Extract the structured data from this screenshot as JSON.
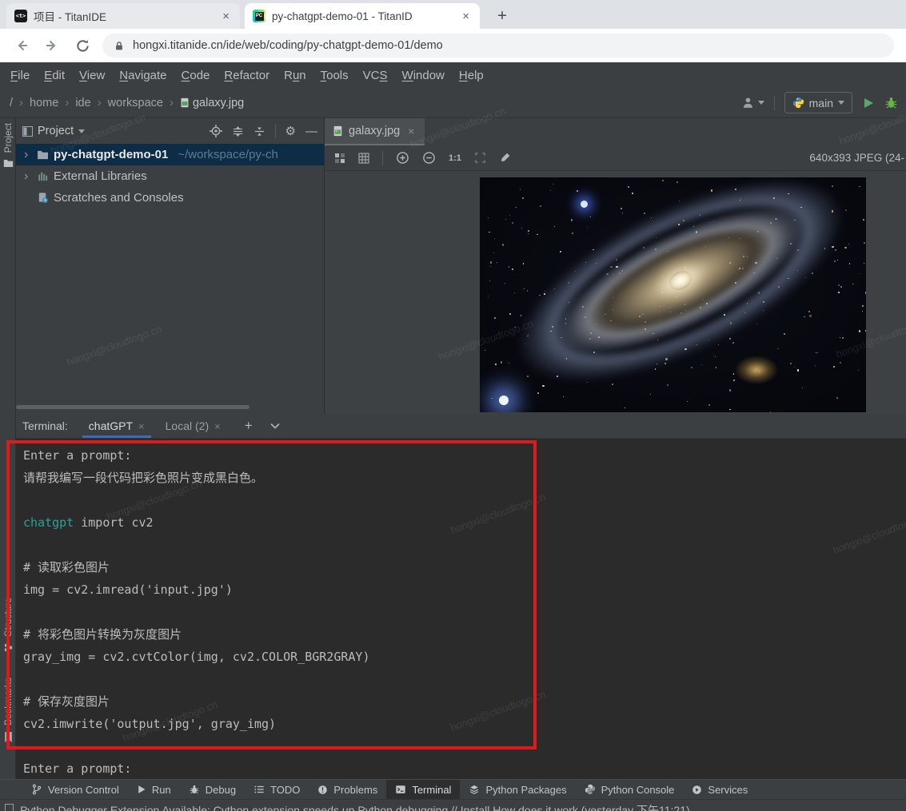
{
  "colors": {
    "accent_teal": "#2aa198",
    "red_box": "#e01a1a",
    "tree_selection": "#0d2c45",
    "terminal_tab_underline": "#3a6db3",
    "run_green": "#59a869",
    "bug_green": "#62b543"
  },
  "browser": {
    "tabs": [
      {
        "title": "项目 - TitanIDE",
        "favicon": "titanide-logo",
        "favicon_glyph": "<t>"
      },
      {
        "title": "py-chatgpt-demo-01 - TitanID",
        "favicon": "pycharm-logo",
        "favicon_glyph": "PC"
      }
    ],
    "new_tab_label": "+",
    "url": "hongxi.titanide.cn/ide/web/coding/py-chatgpt-demo-01/demo"
  },
  "ui": {
    "close_glyph": "×",
    "dropdown_glyph": "▼"
  },
  "menu": {
    "items": [
      {
        "label": "File",
        "u": 0
      },
      {
        "label": "Edit",
        "u": 0
      },
      {
        "label": "View",
        "u": 0
      },
      {
        "label": "Navigate",
        "u": 0
      },
      {
        "label": "Code",
        "u": 0
      },
      {
        "label": "Refactor",
        "u": 0
      },
      {
        "label": "Run",
        "u": 1
      },
      {
        "label": "Tools",
        "u": 0
      },
      {
        "label": "VCS",
        "u": 2
      },
      {
        "label": "Window",
        "u": 0
      },
      {
        "label": "Help",
        "u": 0
      }
    ]
  },
  "breadcrumb": {
    "items": [
      "/",
      "home",
      "ide",
      "workspace",
      "galaxy.jpg"
    ]
  },
  "run_widget": {
    "branch": "main"
  },
  "left_stripe": {
    "project": "Project",
    "structure": "Structure",
    "bookmarks": "Bookmarks"
  },
  "project_panel": {
    "title": "Project",
    "tree": [
      {
        "name": "py-chatgpt-demo-01",
        "path": "~/workspace/py-ch"
      },
      {
        "name": "External Libraries",
        "path": ""
      },
      {
        "name": "Scratches and Consoles",
        "path": ""
      }
    ]
  },
  "editor": {
    "tab_title": "galaxy.jpg",
    "zoom_label": "1:1",
    "image_info": "640x393 JPEG (24-"
  },
  "terminal": {
    "label": "Terminal:",
    "tabs": [
      {
        "name": "chatGPT"
      },
      {
        "name": "Local (2)"
      }
    ],
    "lines": [
      [
        {
          "t": "Enter a prompt:"
        }
      ],
      [
        {
          "t": "请帮我编写一段代码把彩色照片变成黑白色。"
        }
      ],
      [],
      [
        {
          "t": "chatgpt",
          "c": "accent"
        },
        {
          "t": " import cv2"
        }
      ],
      [],
      [
        {
          "t": "# 读取彩色图片"
        }
      ],
      [
        {
          "t": "img = cv2.imread('input.jpg')"
        }
      ],
      [],
      [
        {
          "t": "# 将彩色图片转换为灰度图片"
        }
      ],
      [
        {
          "t": "gray_img = cv2.cvtColor(img, cv2.COLOR_BGR2GRAY)"
        }
      ],
      [],
      [
        {
          "t": "# 保存灰度图片"
        }
      ],
      [
        {
          "t": "cv2.imwrite('output.jpg', gray_img)"
        }
      ],
      [],
      [
        {
          "t": "Enter a prompt:"
        }
      ]
    ]
  },
  "status_bar": {
    "items": [
      {
        "label": "Version Control",
        "icon": "branch"
      },
      {
        "label": "Run",
        "icon": "run"
      },
      {
        "label": "Debug",
        "icon": "bug"
      },
      {
        "label": "TODO",
        "icon": "todo"
      },
      {
        "label": "Problems",
        "icon": "problems"
      },
      {
        "label": "Terminal",
        "icon": "terminal",
        "selected": true
      },
      {
        "label": "Python Packages",
        "icon": "packages"
      },
      {
        "label": "Python Console",
        "icon": "python"
      },
      {
        "label": "Services",
        "icon": "services"
      }
    ]
  },
  "notification": {
    "text": "Python Debugger Extension Available: Cython extension speeds up Python debugging // Install   How does it work (yesterday 下午11:21)"
  },
  "watermark": "hongxi@cloudtogo.cn"
}
